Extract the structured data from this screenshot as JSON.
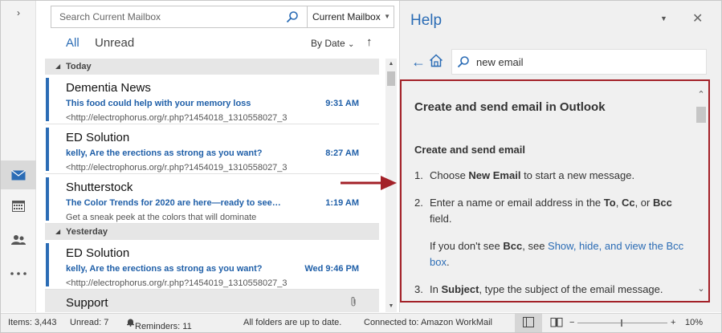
{
  "search": {
    "placeholder": "Search Current Mailbox",
    "scope": "Current Mailbox"
  },
  "filters": {
    "tab_all": "All",
    "tab_unread": "Unread",
    "sort": "By Date",
    "sort_direction": "↑"
  },
  "groups": {
    "today": "Today",
    "yesterday": "Yesterday"
  },
  "messages": [
    {
      "sender": "Dementia News",
      "subject": "This food could help with your memory loss",
      "time": "9:31 AM",
      "preview": "<http://electrophorus.org/r.php?1454018_1310558027_3"
    },
    {
      "sender": "ED Solution",
      "subject": "kelly, Are the erections as strong as you want?",
      "time": "8:27 AM",
      "preview": "<http://electrophorus.org/r.php?1454019_1310558027_3"
    },
    {
      "sender": "Shutterstock",
      "subject": "The Color Trends for 2020 are here—ready to see the f...",
      "time": "1:19 AM",
      "preview": "Get a sneak peek at the colors that will dominate"
    },
    {
      "sender": "ED Solution",
      "subject": "kelly, Are the erections as strong as you want?",
      "time": "Wed 9:46 PM",
      "preview": "<http://electrophorus.org/r.php?1454019_1310558027_3"
    },
    {
      "sender": "Support"
    }
  ],
  "help": {
    "title": "Help",
    "search_text": "new email",
    "article_title": "Create and send email in Outlook",
    "section_title": "Create and send email",
    "step1_num": "1.",
    "step1_a": "Choose ",
    "step1_b": "New Email",
    "step1_c": " to start a new message.",
    "step2_num": "2.",
    "step2_a": "Enter a name or email address in the ",
    "step2_to": "To",
    "step2_sep1": ", ",
    "step2_cc": "Cc",
    "step2_sep2": ", or ",
    "step2_bcc": "Bcc",
    "step2_end": " field.",
    "note_a": "If you don't see ",
    "note_b": "Bcc",
    "note_c": ", see ",
    "note_link": "Show, hide, and view the Bcc box",
    "note_end": ".",
    "step3_num": "3.",
    "step3_a": "In ",
    "step3_b": "Subject",
    "step3_c": ", type the subject of the email message."
  },
  "status": {
    "items": "Items: 3,443",
    "unread": "Unread: 7",
    "reminders": "Reminders: 11",
    "sync": "All folders are up to date.",
    "connection": "Connected to: Amazon WorkMail",
    "zoom_minus": "−",
    "zoom_plus": "+",
    "zoom": "10%"
  },
  "colors": {
    "accent": "#2b6cb5",
    "highlight_border": "#a32128",
    "arrow": "#a32128"
  },
  "icons": [
    "mail-icon",
    "calendar-icon",
    "people-icon",
    "more-icon",
    "search-icon",
    "back-arrow-icon",
    "home-icon",
    "close-icon",
    "attachment-icon",
    "bell-icon"
  ]
}
